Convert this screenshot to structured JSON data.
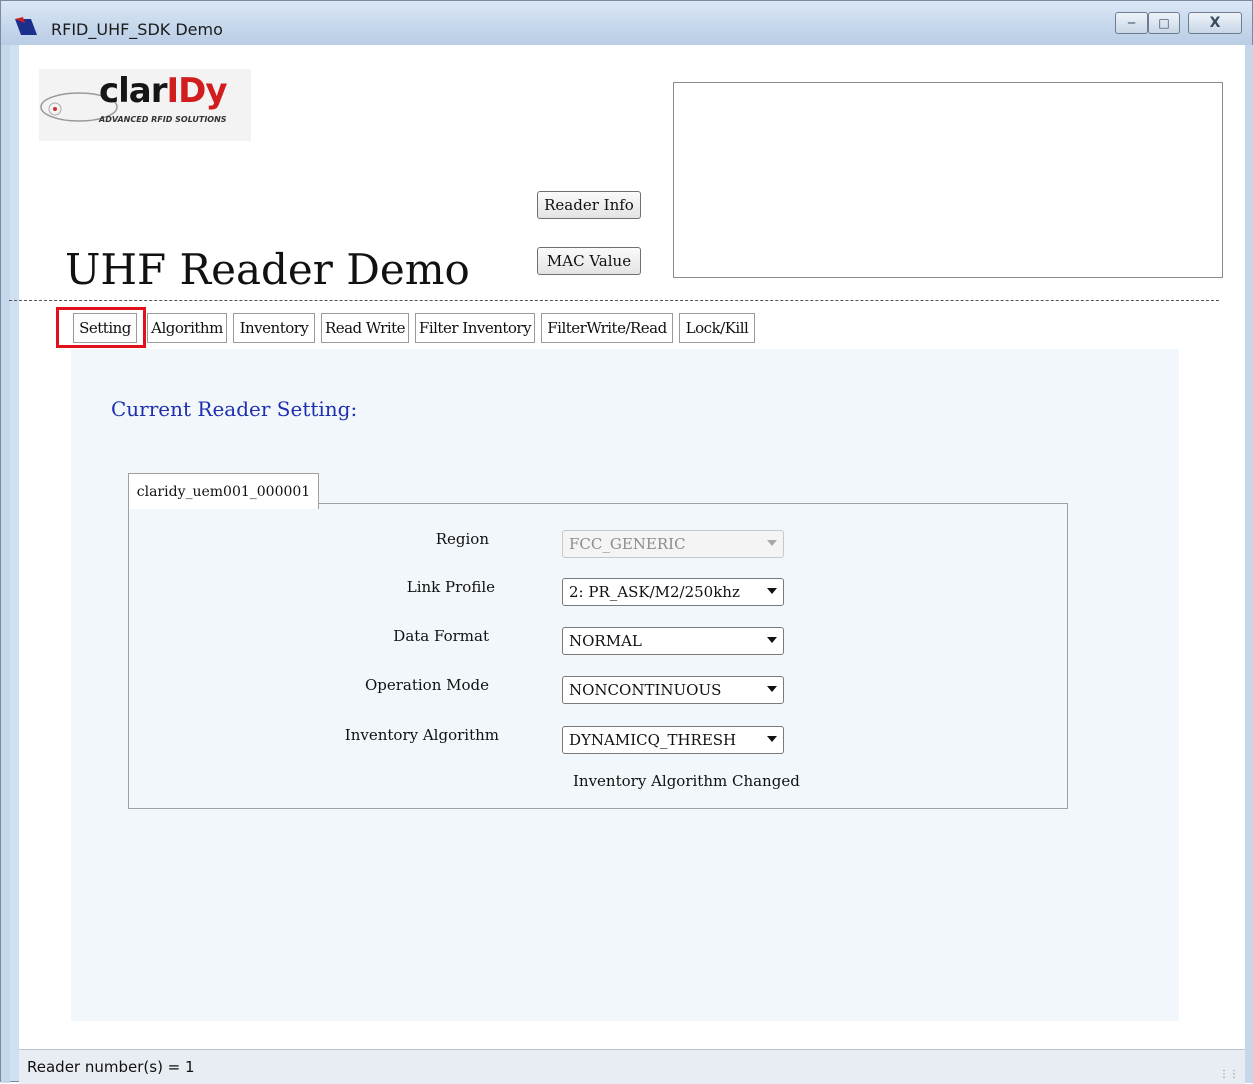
{
  "window": {
    "title": "RFID_UHF_SDK Demo"
  },
  "logo": {
    "word_a": "clar",
    "word_b": "IDy",
    "tagline": "ADVANCED RFID SOLUTIONS"
  },
  "header": {
    "title": "UHF Reader Demo",
    "reader_info_label": "Reader Info",
    "mac_value_label": "MAC Value"
  },
  "tabs": [
    "Setting",
    "Algorithm",
    "Inventory",
    "Read Write",
    "Filter Inventory",
    "FilterWrite/Read",
    "Lock/Kill"
  ],
  "panel": {
    "heading": "Current Reader Setting:",
    "reader_tab": "claridy_uem001_000001",
    "fields": [
      {
        "label": "Region",
        "value": "FCC_GENERIC",
        "disabled": true
      },
      {
        "label": "Link Profile",
        "value": "2: PR_ASK/M2/250khz"
      },
      {
        "label": "Data Format",
        "value": "NORMAL"
      },
      {
        "label": "Operation Mode",
        "value": "NONCONTINUOUS"
      },
      {
        "label": "Inventory Algorithm",
        "value": "DYNAMICQ_THRESH"
      }
    ],
    "status_message": "Inventory Algorithm Changed"
  },
  "statusbar": {
    "text": "Reader number(s) = 1"
  },
  "colors": {
    "highlight": "#e0111a",
    "heading": "#1f2fb0",
    "panel_bg": "#f1f7fb"
  }
}
